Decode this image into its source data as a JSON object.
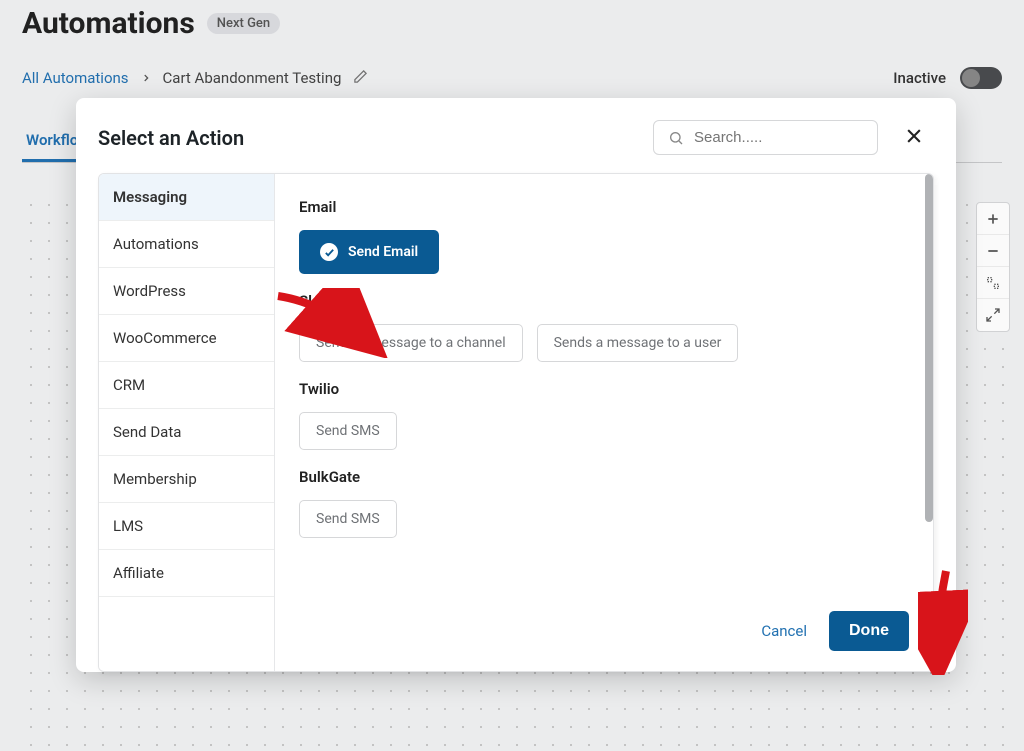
{
  "page": {
    "title": "Automations",
    "badge": "Next Gen",
    "status_label": "Inactive"
  },
  "breadcrumb": {
    "root": "All Automations",
    "current": "Cart Abandonment Testing"
  },
  "tabs": {
    "workflow": "Workflo"
  },
  "modal": {
    "title": "Select an Action",
    "search_placeholder": "Search.....",
    "cancel": "Cancel",
    "done": "Done"
  },
  "sidebar": {
    "items": [
      "Messaging",
      "Automations",
      "WordPress",
      "WooCommerce",
      "CRM",
      "Send Data",
      "Membership",
      "LMS",
      "Affiliate"
    ]
  },
  "sections": [
    {
      "label": "Email",
      "actions": [
        {
          "label": "Send Email",
          "selected": true
        }
      ]
    },
    {
      "label": "Slack",
      "actions": [
        {
          "label": "Sends a message to a channel"
        },
        {
          "label": "Sends a message to a user"
        }
      ]
    },
    {
      "label": "Twilio",
      "actions": [
        {
          "label": "Send SMS"
        }
      ]
    },
    {
      "label": "BulkGate",
      "actions": [
        {
          "label": "Send SMS"
        }
      ]
    }
  ]
}
